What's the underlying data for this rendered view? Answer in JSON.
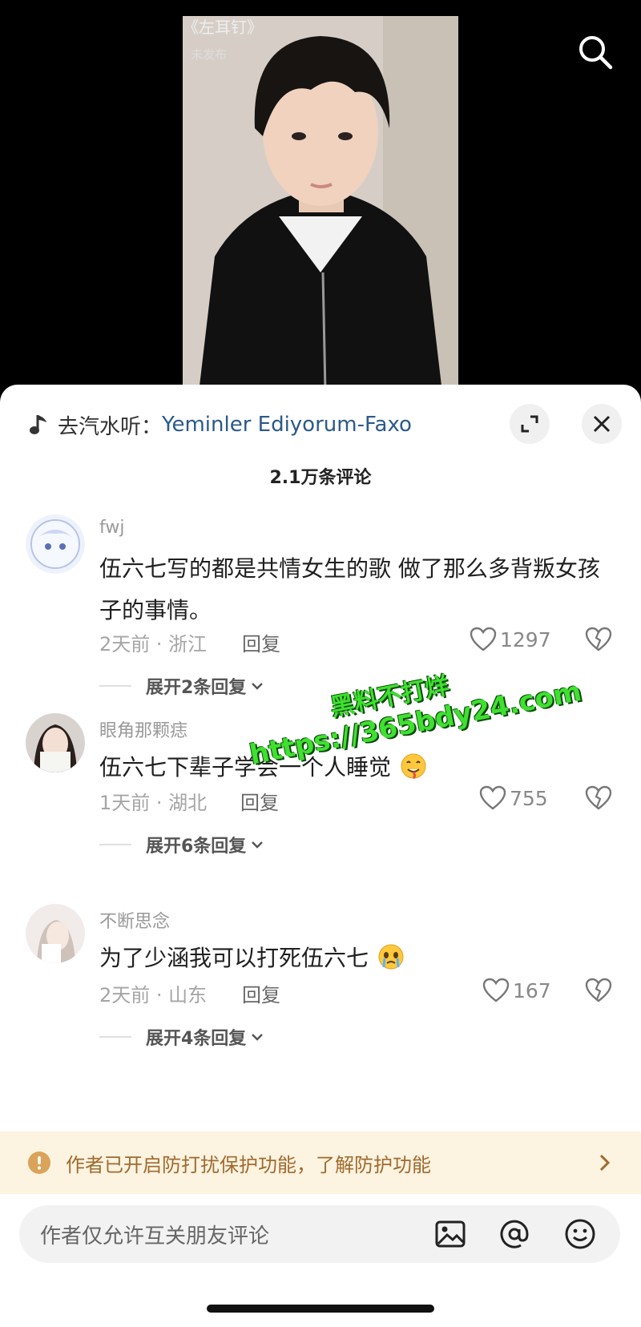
{
  "video": {
    "title": "《左耳钉》",
    "subtitle": "未发布"
  },
  "panel": {
    "music_prefix": "去汽水听：",
    "music_title": "Yeminler Ediyorum-Faxo",
    "comment_count": "2.1万条评论"
  },
  "comments": [
    {
      "user": "fwj",
      "text": "伍六七写的都是共情女生的歌 做了那么多背叛女孩子的事情。",
      "meta": "2天前 · 浙江",
      "reply": "回复",
      "likes": "1297",
      "expand": "展开2条回复"
    },
    {
      "user": "眼角那颗痣",
      "text": "伍六七下辈子学会一个人睡觉",
      "emoji": "drooling-face",
      "meta": "1天前 · 湖北",
      "reply": "回复",
      "likes": "755",
      "expand": "展开6条回复"
    },
    {
      "user": "不断思念",
      "text": "为了少涵我可以打死伍六七",
      "emoji": "crying-face",
      "meta": "2天前 · 山东",
      "reply": "回复",
      "likes": "167",
      "expand": "展开4条回复"
    }
  ],
  "notice": {
    "text": "作者已开启防打扰保护功能，了解防护功能"
  },
  "input": {
    "placeholder": "作者仅允许互关朋友评论"
  },
  "watermark": {
    "line1": "黑料不打烊",
    "line2": "https://365bdy24.com"
  },
  "icons": [
    "search-icon",
    "music-note-icon",
    "expand-icon",
    "close-icon",
    "heart-icon",
    "broken-heart-icon",
    "chevron-down-icon",
    "info-icon",
    "chevron-right-icon",
    "image-icon",
    "at-icon",
    "emoji-icon"
  ],
  "colors": {
    "music_title": "#2a5a8a",
    "notice_bg": "#fdf3e1",
    "notice_text": "#a06a2d",
    "watermark": "#3fe02f"
  }
}
